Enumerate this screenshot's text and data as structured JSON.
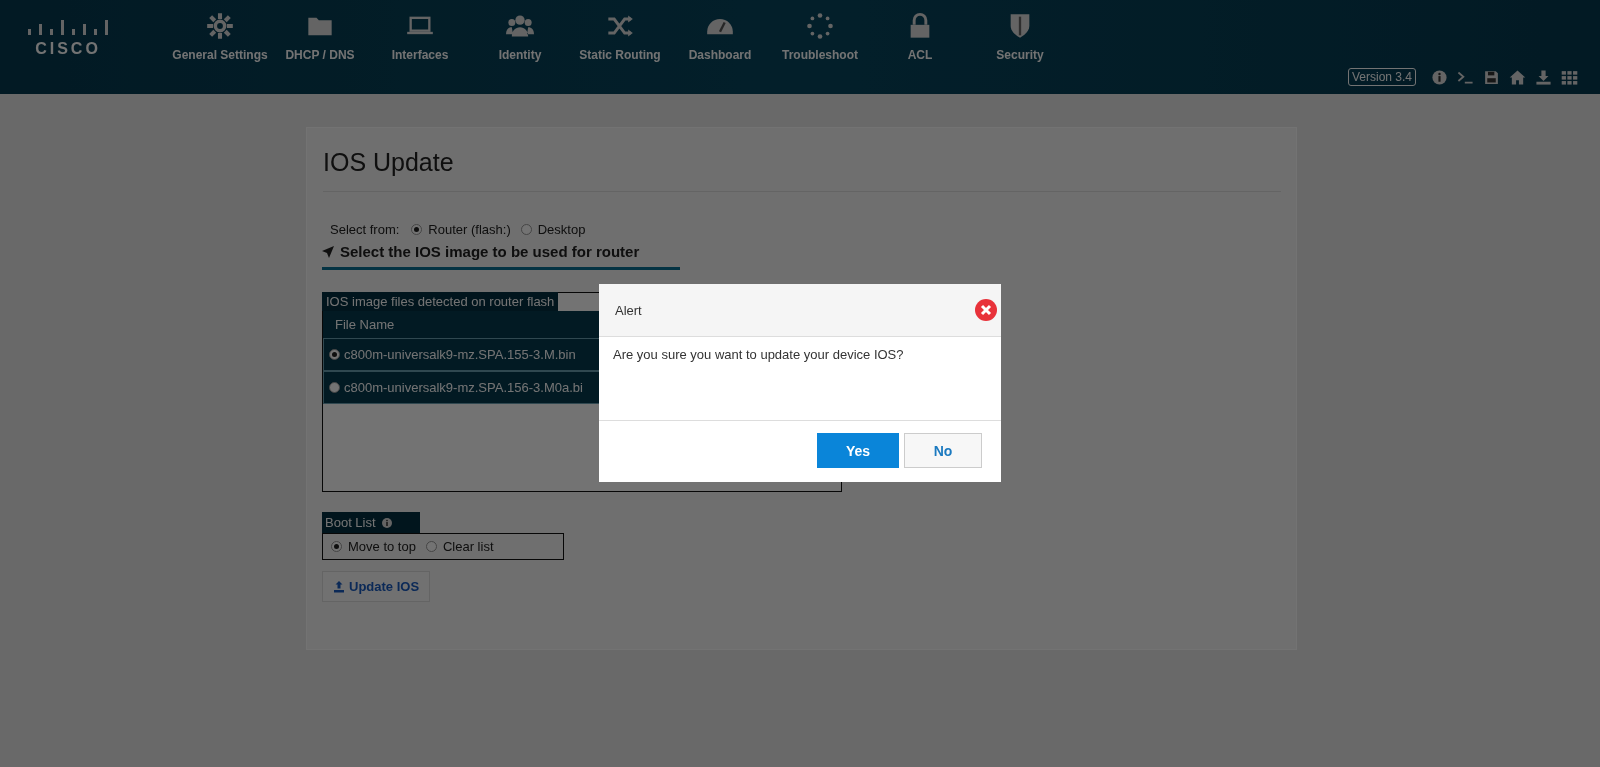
{
  "header": {
    "logo": "CISCO",
    "nav": [
      {
        "label": "General Settings"
      },
      {
        "label": "DHCP / DNS"
      },
      {
        "label": "Interfaces"
      },
      {
        "label": "Identity"
      },
      {
        "label": "Static Routing"
      },
      {
        "label": "Dashboard"
      },
      {
        "label": "Troubleshoot"
      },
      {
        "label": "ACL"
      },
      {
        "label": "Security"
      }
    ],
    "version": "Version 3.4"
  },
  "panel": {
    "title": "IOS Update",
    "select_from": {
      "label": "Select from:",
      "options": [
        {
          "label": "Router (flash:)",
          "selected": true
        },
        {
          "label": "Desktop",
          "selected": false
        }
      ]
    },
    "section_title": "Select the IOS image to be used for router",
    "files": {
      "caption": "IOS image files detected on router flash",
      "column": "File Name",
      "rows": [
        {
          "name": "c800m-universalk9-mz.SPA.155-3.M.bin",
          "selected": true
        },
        {
          "name": "c800m-universalk9-mz.SPA.156-3.M0a.bi",
          "selected": false
        }
      ]
    },
    "boot_list": {
      "label": "Boot List",
      "options": [
        {
          "label": "Move to top",
          "selected": true
        },
        {
          "label": "Clear list",
          "selected": false
        }
      ]
    },
    "update_button": "Update IOS"
  },
  "dialog": {
    "title": "Alert",
    "message": "Are you sure you want to update your device IOS?",
    "buttons": [
      {
        "label": "Yes",
        "kind": "primary"
      },
      {
        "label": "No",
        "kind": "secondary"
      }
    ]
  }
}
